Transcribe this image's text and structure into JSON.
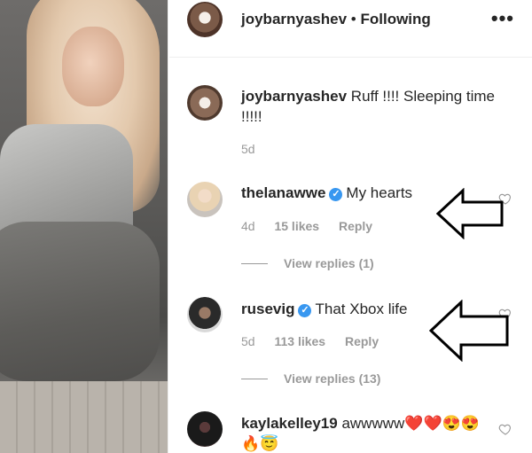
{
  "post_header": {
    "username": "joybarnyashev",
    "separator": "•",
    "follow_status": "Following",
    "more_icon": "more-options-icon"
  },
  "caption": {
    "username": "joybarnyashev",
    "text": "Ruff !!!! Sleeping time !!!!!",
    "time": "5d"
  },
  "comments": [
    {
      "username": "thelanawwe",
      "verified": true,
      "text": "My hearts",
      "time": "4d",
      "likes": "15 likes",
      "reply": "Reply",
      "view_replies": "View replies (1)"
    },
    {
      "username": "rusevig",
      "verified": true,
      "text": "That Xbox life",
      "time": "5d",
      "likes": "113 likes",
      "reply": "Reply",
      "view_replies": "View replies (13)"
    },
    {
      "username": "kaylakelley19",
      "verified": false,
      "text": "awwwww❤️❤️😍😍",
      "text_line2": "🔥😇"
    }
  ],
  "colors": {
    "verified_badge": "#3897f0",
    "meta_gray": "#999999",
    "text": "#262626"
  }
}
